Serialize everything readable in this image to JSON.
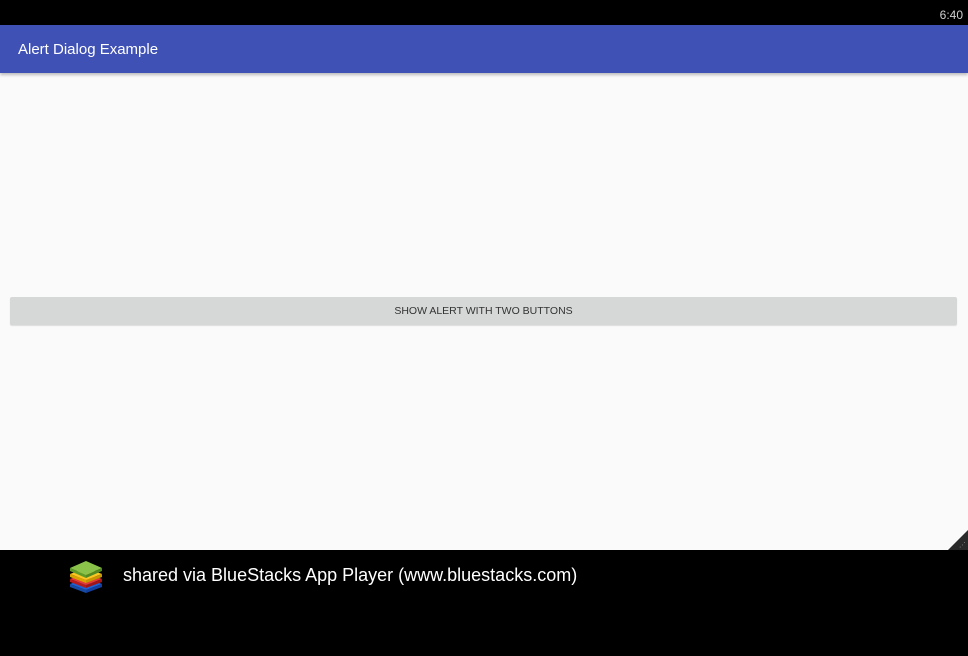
{
  "status_bar": {
    "time": "6:40"
  },
  "app_bar": {
    "title": "Alert Dialog Example"
  },
  "main": {
    "button_label": "SHOW ALERT WITH TWO BUTTONS"
  },
  "footer": {
    "logo_icon": "bluestacks-logo-icon",
    "text": "shared via BlueStacks App Player (www.bluestacks.com)"
  },
  "colors": {
    "app_bar": "#3f51b5",
    "content_background": "#fafafa",
    "button_background": "#d6d7d7",
    "frame": "#000000"
  }
}
